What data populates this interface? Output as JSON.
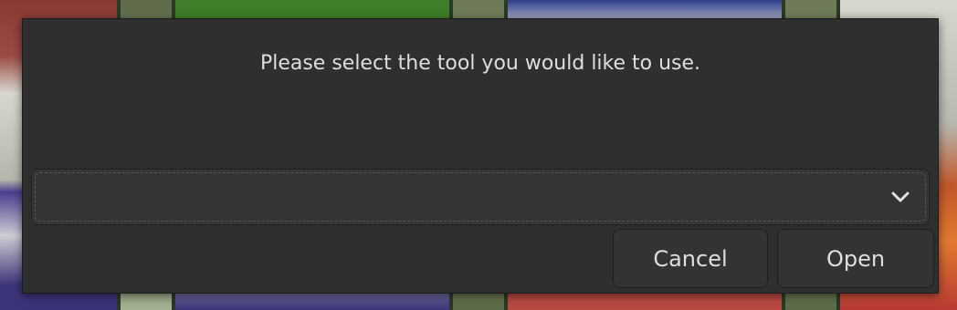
{
  "dialog": {
    "message": "Please select the tool you would like to use.",
    "tool_select": {
      "value": "",
      "icon": "chevron-down-icon"
    },
    "buttons": {
      "cancel": "Cancel",
      "open": "Open"
    }
  },
  "colors": {
    "dialog_bg": "#2f2f2f",
    "text": "#dedede",
    "border": "#1f1f1f"
  }
}
